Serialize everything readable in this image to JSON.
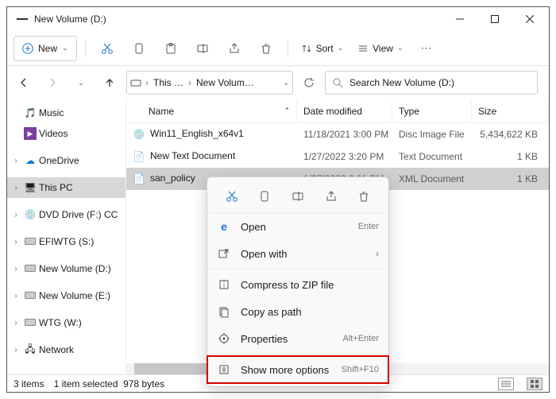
{
  "window": {
    "title": "New Volume (D:)"
  },
  "toolbar": {
    "new_label": "New",
    "sort_label": "Sort",
    "view_label": "View"
  },
  "breadcrumb": {
    "seg1": "This …",
    "seg2": "New Volum…"
  },
  "search": {
    "placeholder": "Search New Volume (D:)"
  },
  "sidebar": {
    "items": [
      {
        "label": "Music"
      },
      {
        "label": "Videos"
      },
      {
        "label": "OneDrive"
      },
      {
        "label": "This PC"
      },
      {
        "label": "DVD Drive (F:) CC"
      },
      {
        "label": "EFIWTG (S:)"
      },
      {
        "label": "New Volume (D:)"
      },
      {
        "label": "New Volume (E:)"
      },
      {
        "label": "WTG (W:)"
      },
      {
        "label": "Network"
      }
    ]
  },
  "columns": {
    "name": "Name",
    "date": "Date modified",
    "type": "Type",
    "size": "Size"
  },
  "rows": [
    {
      "name": "Win11_English_x64v1",
      "date": "11/18/2021 3:00 PM",
      "type": "Disc Image File",
      "size": "5,434,622 KB"
    },
    {
      "name": "New Text Document",
      "date": "1/27/2022 3:20 PM",
      "type": "Text Document",
      "size": "1 KB"
    },
    {
      "name": "san_policy",
      "date": "1/27/2022 3:31 PM",
      "type": "XML Document",
      "size": "1 KB"
    }
  ],
  "context": {
    "open": "Open",
    "open_k": "Enter",
    "openwith": "Open with",
    "zip": "Compress to ZIP file",
    "copypath": "Copy as path",
    "props": "Properties",
    "props_k": "Alt+Enter",
    "more": "Show more options",
    "more_k": "Shift+F10"
  },
  "status": {
    "count": "3 items",
    "sel": "1 item selected",
    "bytes": "978 bytes"
  }
}
